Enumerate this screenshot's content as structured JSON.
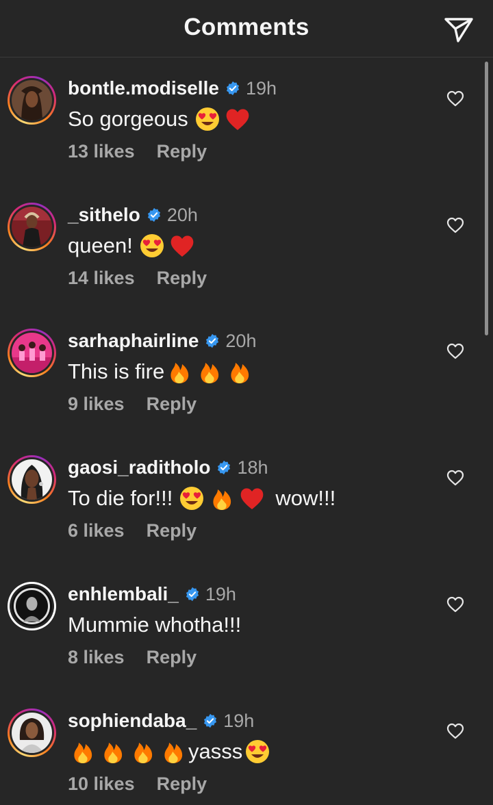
{
  "header": {
    "title": "Comments",
    "send_icon": "paper-plane-icon"
  },
  "colors": {
    "background": "#262626",
    "verified": "#3797f0",
    "secondary_text": "#a8a8a8",
    "heart_red": "#e02424",
    "flame_orange": "#ff7a00"
  },
  "comments": [
    {
      "username": "bontle.modiselle",
      "time": "19h",
      "text": "So gorgeous",
      "emojis": [
        "heart-eyes",
        "red-heart"
      ],
      "likes": "13 likes",
      "reply": "Reply"
    },
    {
      "username": "_sithelo",
      "time": "20h",
      "text": "queen!",
      "emojis": [
        "heart-eyes",
        "red-heart"
      ],
      "likes": "14 likes",
      "reply": "Reply"
    },
    {
      "username": "sarhaphairline",
      "time": "20h",
      "text": "This is fire",
      "emojis": [
        "fire",
        "fire",
        "fire"
      ],
      "likes": "9 likes",
      "reply": "Reply"
    },
    {
      "username": "gaosi_raditholo",
      "time": "18h",
      "text": "To die for!!!",
      "emojis": [
        "heart-eyes",
        "fire",
        "red-heart"
      ],
      "trailing_text": "wow!!!",
      "likes": "6 likes",
      "reply": "Reply"
    },
    {
      "username": "enhlembali_",
      "time": "19h",
      "text": "Mummie whotha!!!",
      "emojis": [],
      "likes": "8 likes",
      "reply": "Reply"
    },
    {
      "username": "sophiendaba_",
      "time": "19h",
      "text": "yasss",
      "leading_emojis": [
        "fire",
        "fire",
        "fire",
        "fire"
      ],
      "emojis": [
        "heart-eyes"
      ],
      "likes": "10 likes",
      "reply": "Reply"
    }
  ]
}
